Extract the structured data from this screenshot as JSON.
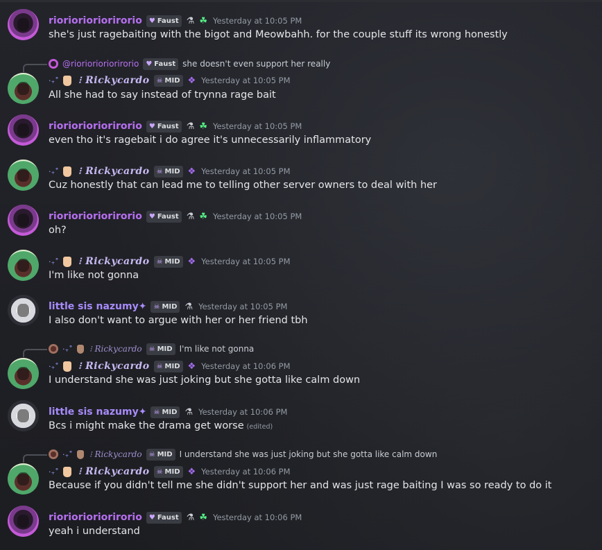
{
  "users": {
    "riorio": {
      "name": "rioriorioriorirorio",
      "tag": "Faust"
    },
    "rick": {
      "prefix": "·₊˚",
      "name": "⁝ Rickycardo",
      "tag": "MID"
    },
    "nazumy": {
      "name": "little sis nazumy✦",
      "tag": "MID"
    }
  },
  "reply_mention": "@rioriorioriorirorio",
  "messages": [
    {
      "time": "Yesterday at 10:05 PM",
      "text": "she's just ragebaiting with the bigot and Meowbahh. for the couple stuff its wrong honestly"
    },
    {
      "reply_text": "she doesn't even support her really",
      "time": "Yesterday at 10:05 PM",
      "text": "All she had to say instead of trynna rage bait"
    },
    {
      "time": "Yesterday at 10:05 PM",
      "text": "even tho it's ragebait i do agree it's unnecessarily inflammatory"
    },
    {
      "time": "Yesterday at 10:05 PM",
      "text": "Cuz honestly that can lead me to telling other server owners to deal with her"
    },
    {
      "time": "Yesterday at 10:05 PM",
      "text": "oh?"
    },
    {
      "time": "Yesterday at 10:05 PM",
      "text": "I'm like not gonna"
    },
    {
      "time": "Yesterday at 10:05 PM",
      "text": "I also don't want to argue with her or her friend tbh"
    },
    {
      "reply_text": "I'm like not gonna",
      "time": "Yesterday at 10:06 PM",
      "text": "I understand she was just joking but she gotta like calm down"
    },
    {
      "time": "Yesterday at 10:06 PM",
      "text": "Bcs i might make the drama get worse",
      "edited": "(edited)"
    },
    {
      "reply_text": "I understand she was just joking but she gotta like calm down",
      "time": "Yesterday at 10:06 PM",
      "text": "Because if you didn't tell me she didn't support her and was just rage baiting I was so ready to do it"
    },
    {
      "time": "Yesterday at 10:06 PM",
      "text": "yeah i understand"
    }
  ],
  "icons": {
    "tag_heart": "heart-icon",
    "tag_skull": "skull-icon",
    "flask": "flask-icon",
    "clover": "clover-icon",
    "bat": "bat-icon"
  }
}
